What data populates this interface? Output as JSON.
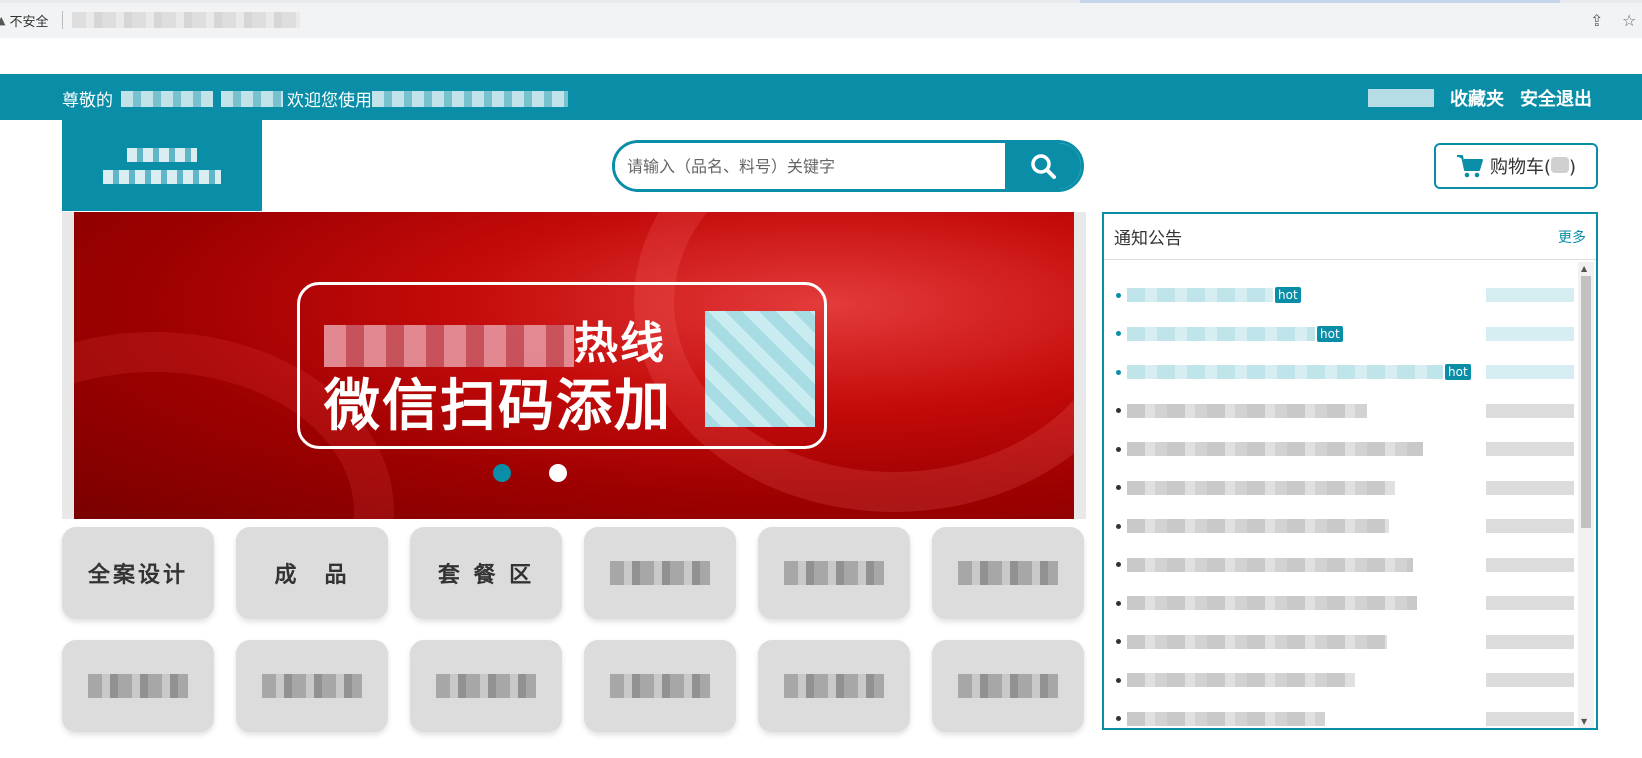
{
  "browser": {
    "security_label": "不安全"
  },
  "topbar": {
    "welcome_prefix": "尊敬的",
    "welcome_middle": "欢迎您使用",
    "favorites": "收藏夹",
    "logout": "安全退出"
  },
  "search": {
    "placeholder": "请输入（品名、料号）关键字"
  },
  "cart": {
    "label": "购物车(",
    "suffix": ")"
  },
  "banner": {
    "line1_tail": "热线",
    "line2": "微信扫码添加"
  },
  "categories": {
    "row1": [
      "全案设计",
      "成　品",
      "套 餐 区"
    ]
  },
  "notice": {
    "title": "通知公告",
    "more": "更多",
    "hot": "hot"
  },
  "colors": {
    "brand_teal": "#0a8ea8",
    "banner_red": "#c40a0a"
  }
}
